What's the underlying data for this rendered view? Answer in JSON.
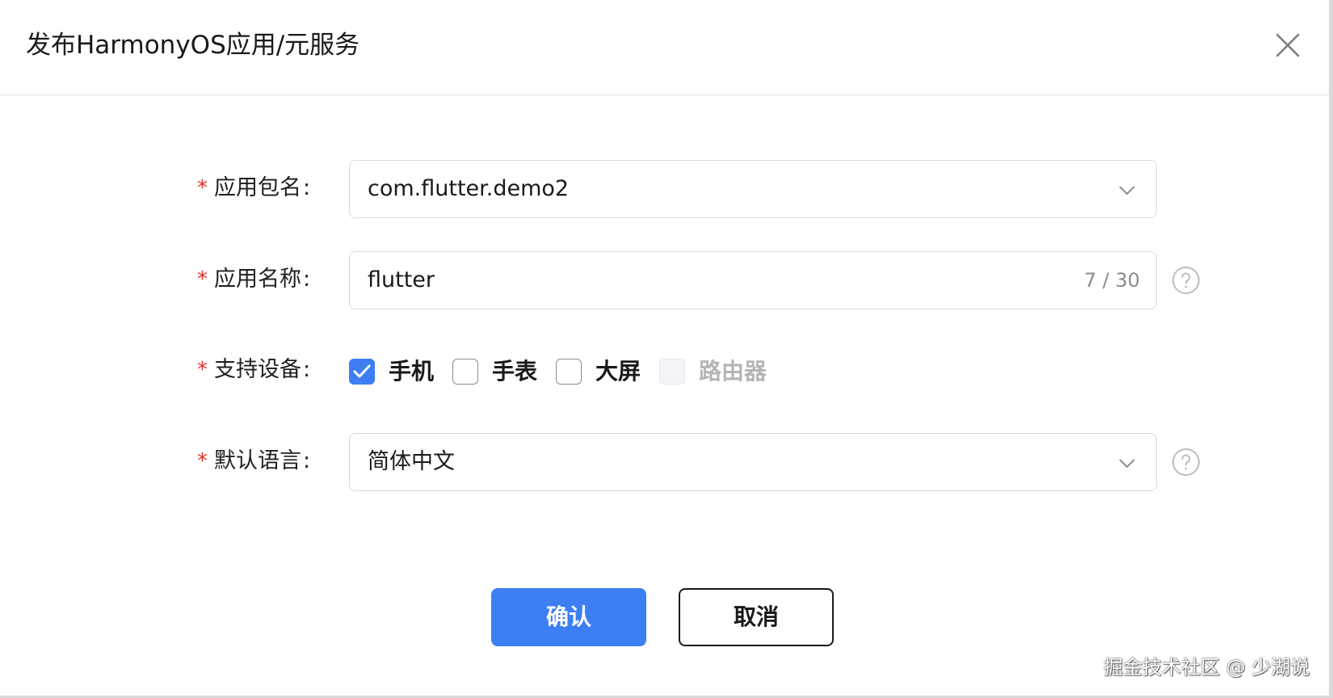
{
  "dialog": {
    "title": "发布HarmonyOS应用/元服务",
    "close_icon": "close-icon"
  },
  "form": {
    "package": {
      "required_mark": "*",
      "label": "应用包名",
      "colon": ":",
      "value": "com.flutter.demo2",
      "icon": "chevron-down-icon"
    },
    "app_name": {
      "required_mark": "*",
      "label": "应用名称",
      "colon": ":",
      "value": "flutter",
      "counter": "7 / 30",
      "help_icon": "question-circle-icon"
    },
    "devices": {
      "required_mark": "*",
      "label": "支持设备",
      "colon": ":",
      "options": [
        {
          "label": "手机",
          "checked": true,
          "disabled": false
        },
        {
          "label": "手表",
          "checked": false,
          "disabled": false
        },
        {
          "label": "大屏",
          "checked": false,
          "disabled": false
        },
        {
          "label": "路由器",
          "checked": false,
          "disabled": true
        }
      ]
    },
    "language": {
      "required_mark": "*",
      "label": "默认语言",
      "colon": ":",
      "value": "简体中文",
      "icon": "chevron-down-icon",
      "help_icon": "question-circle-icon"
    }
  },
  "buttons": {
    "confirm": "确认",
    "cancel": "取消"
  },
  "watermark": "掘金技术社区 @ 少湖说",
  "colors": {
    "primary": "#3d7ff2",
    "required": "#e0322b",
    "disabled_text": "#b5b5b5"
  }
}
